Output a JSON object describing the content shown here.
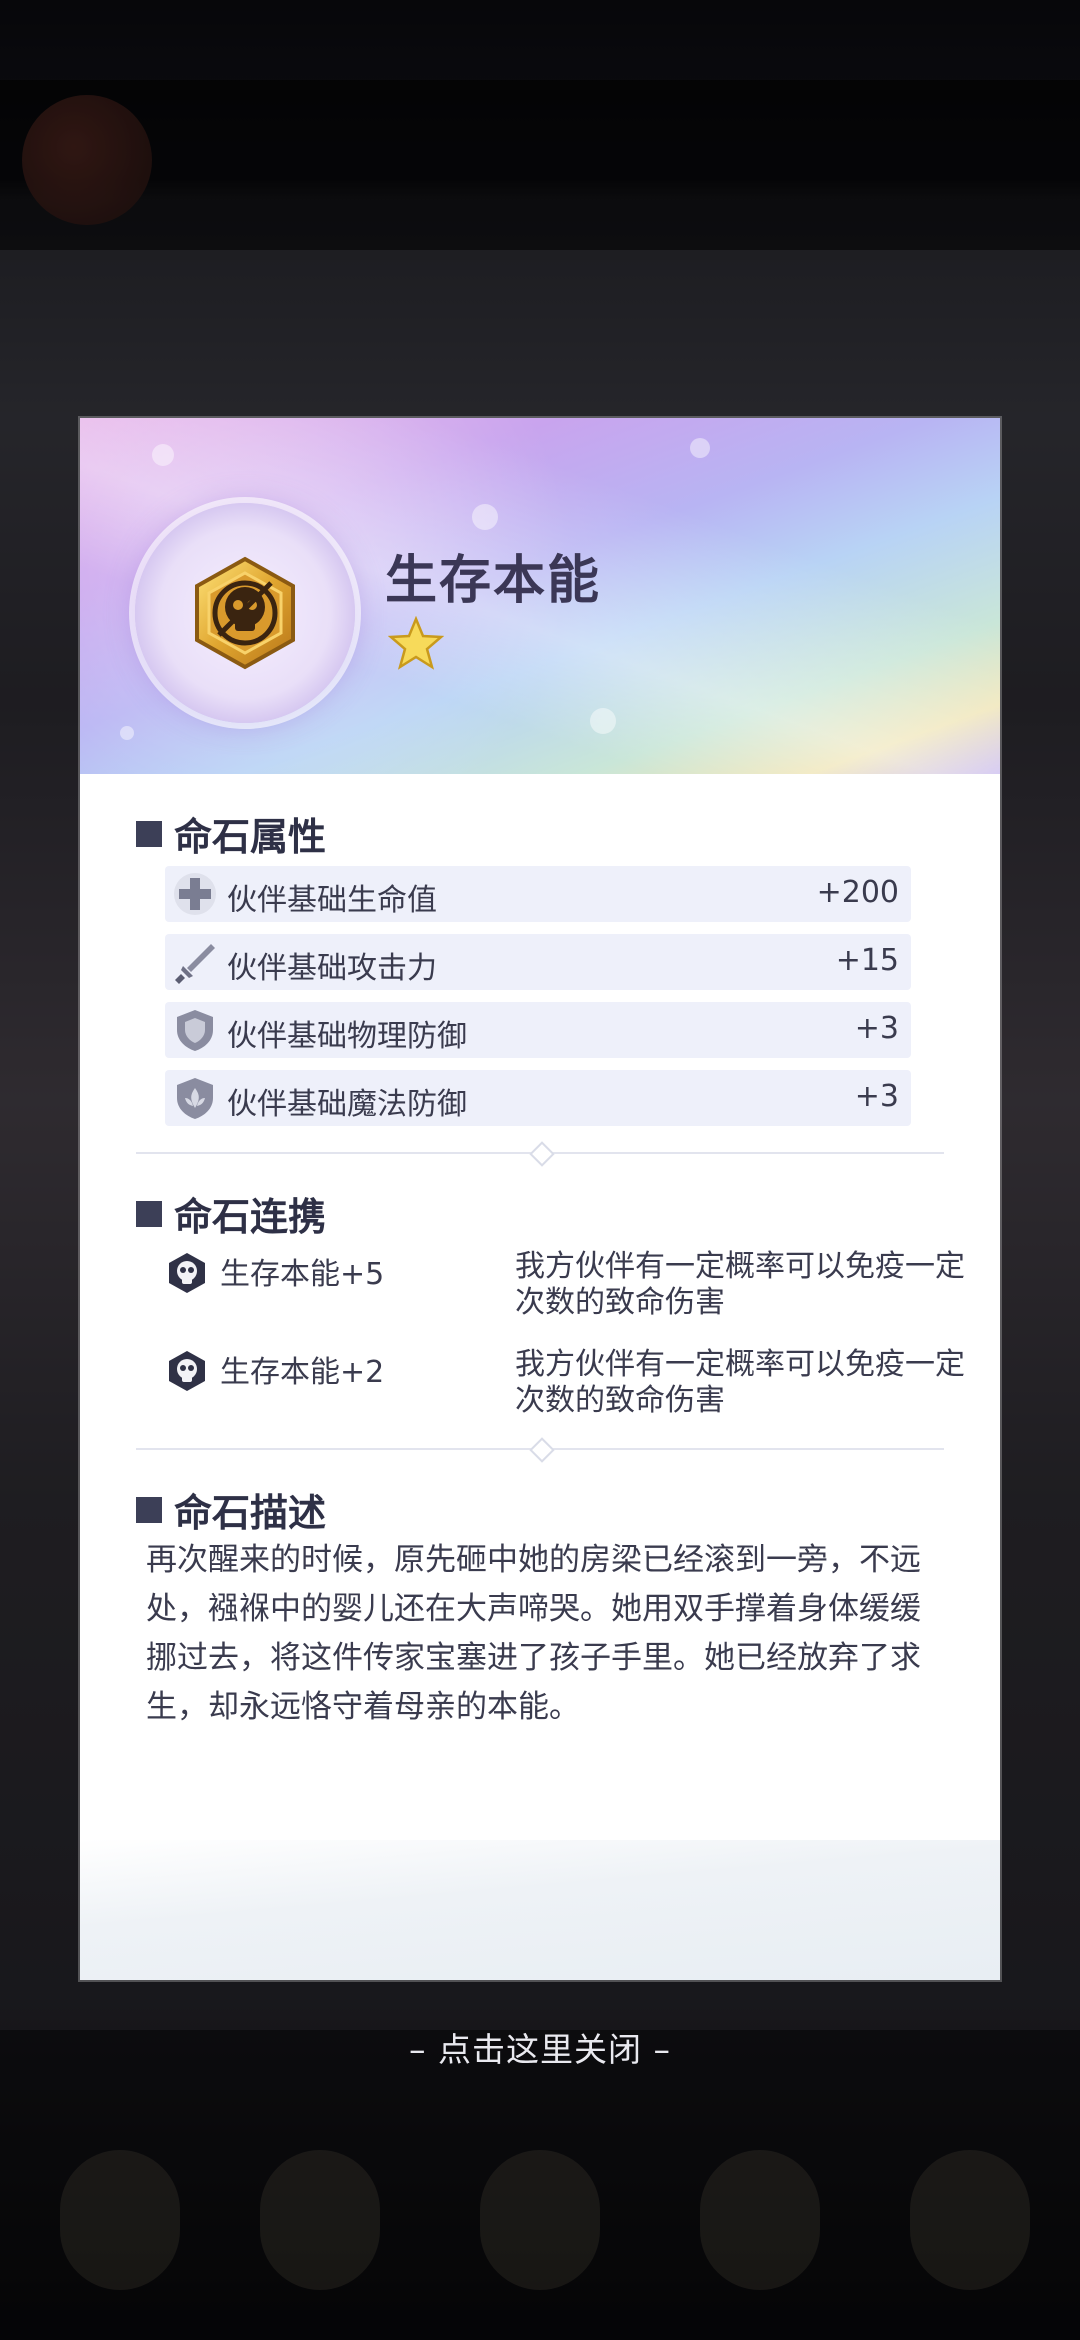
{
  "card": {
    "title": "生存本能",
    "stars": 1,
    "accent_color": "#3c3f57"
  },
  "attributes": {
    "heading": "命石属性",
    "rows": [
      {
        "icon": "plus-cross-icon",
        "label": "伙伴基础生命值",
        "value": "+200"
      },
      {
        "icon": "sword-icon",
        "label": "伙伴基础攻击力",
        "value": "+15"
      },
      {
        "icon": "shield-icon",
        "label": "伙伴基础物理防御",
        "value": "+3"
      },
      {
        "icon": "magic-shield-icon",
        "label": "伙伴基础魔法防御",
        "value": "+3"
      }
    ]
  },
  "synergy": {
    "heading": "命石连携",
    "rows": [
      {
        "icon": "skull-icon",
        "label": "生存本能+5",
        "desc": "我方伙伴有一定概率可以免疫一定次数的致命伤害"
      },
      {
        "icon": "skull-icon",
        "label": "生存本能+2",
        "desc": "我方伙伴有一定概率可以免疫一定次数的致命伤害"
      }
    ]
  },
  "description": {
    "heading": "命石描述",
    "text": "再次醒来的时候，原先砸中她的房梁已经滚到一旁，不远处，襁褓中的婴儿还在大声啼哭。她用双手撑着身体缓缓挪过去，将这件传家宝塞进了孩子手里。她已经放弃了求生，却永远恪守着母亲的本能。"
  },
  "close_hint": "– 点击这里关闭 –"
}
